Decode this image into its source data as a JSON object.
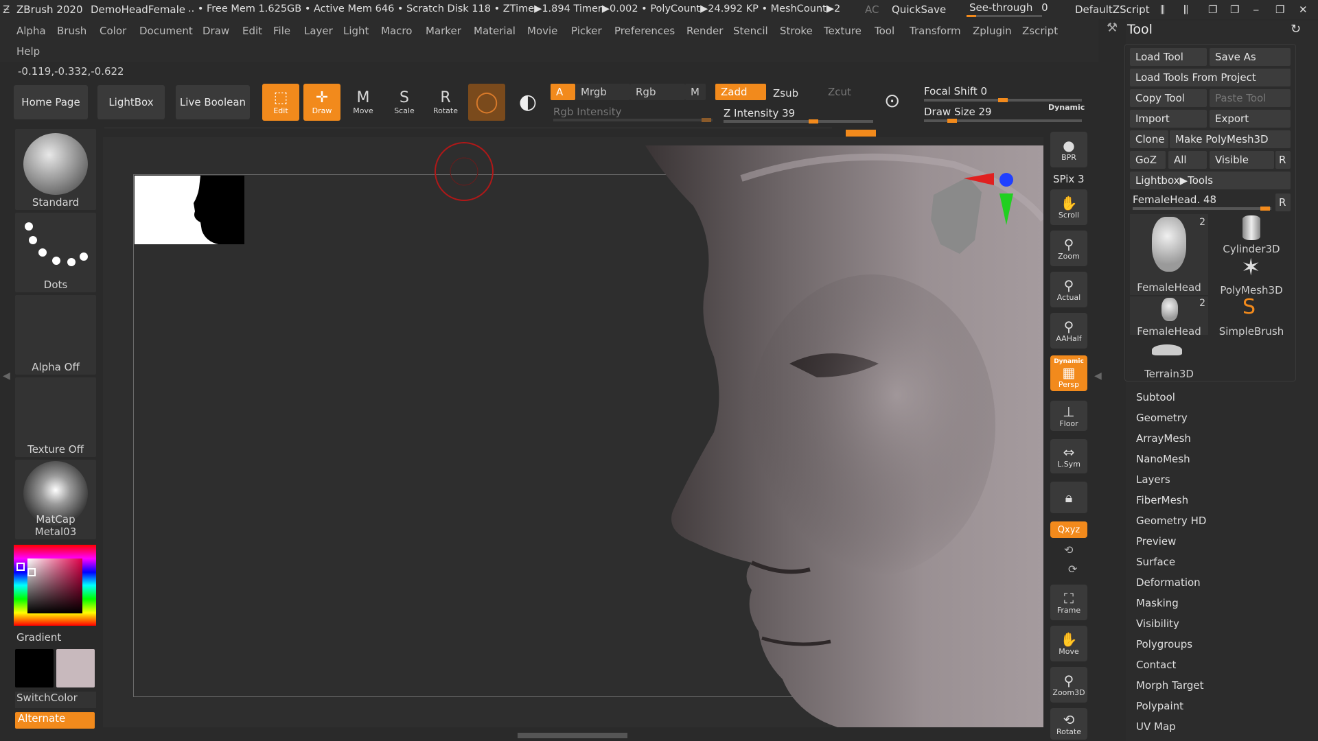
{
  "titlebar": {
    "app": "ZBrush 2020",
    "document": "DemoHeadFemale",
    "stats": ".. • Free Mem 1.625GB • Active Mem 646 • Scratch Disk 118 • ZTime▶1.894 Timer▶0.002 • PolyCount▶24.992 KP • MeshCount▶2",
    "ac": "AC",
    "quicksave": "QuickSave",
    "see_through": "See-through",
    "see_through_value": "0",
    "script": "DefaultZScript"
  },
  "menus": [
    "Alpha",
    "Brush",
    "Color",
    "Document",
    "Draw",
    "Edit",
    "File",
    "Layer",
    "Light",
    "Macro",
    "Marker",
    "Material",
    "Movie",
    "Picker",
    "Preferences",
    "Render",
    "Stencil",
    "Stroke",
    "Texture",
    "Tool",
    "Transform",
    "Zplugin",
    "Zscript"
  ],
  "menu_help": "Help",
  "coords": "-0.119,-0.332,-0.622",
  "top_buttons": {
    "home": "Home Page",
    "lightbox": "LightBox",
    "live_boolean": "Live Boolean"
  },
  "tool_icons": [
    {
      "label": "Edit",
      "icon": "edit-icon",
      "active": true
    },
    {
      "label": "Draw",
      "icon": "draw-icon",
      "active": true
    },
    {
      "label": "Move",
      "icon": "move-icon",
      "active": false
    },
    {
      "label": "Scale",
      "icon": "scale-icon",
      "active": false
    },
    {
      "label": "Rotate",
      "icon": "rotate-icon",
      "active": false
    }
  ],
  "color_controls": {
    "a": "A",
    "mrgb": "Mrgb",
    "rgb": "Rgb",
    "m": "M",
    "zadd": "Zadd",
    "zsub": "Zsub",
    "zcut": "Zcut",
    "rgb_intensity": "Rgb Intensity",
    "z_intensity": "Z Intensity 39"
  },
  "brush_controls": {
    "focal_shift": "Focal Shift 0",
    "draw_size": "Draw Size 29",
    "dynamic": "Dynamic"
  },
  "left_panel": {
    "brush": "Standard",
    "stroke": "Dots",
    "alpha": "Alpha Off",
    "texture": "Texture Off",
    "material": "MatCap Metal03",
    "gradient": "Gradient",
    "switch_color": "SwitchColor",
    "alternate": "Alternate"
  },
  "right_strip": {
    "bpr": "BPR",
    "spix": "SPix 3",
    "buttons": [
      "Scroll",
      "Zoom",
      "Actual",
      "AAHalf"
    ],
    "persp_top": "Dynamic",
    "persp": "Persp",
    "floor": "Floor",
    "lsym": "L.Sym",
    "xyz": "Qxyz",
    "bottom": [
      "Frame",
      "Move",
      "Zoom3D",
      "Rotate"
    ]
  },
  "tool_panel": {
    "title": "Tool",
    "load_tool": "Load Tool",
    "save_as": "Save As",
    "load_from_project": "Load Tools From Project",
    "copy_tool": "Copy Tool",
    "paste_tool": "Paste Tool",
    "import": "Import",
    "export": "Export",
    "clone": "Clone",
    "make_polymesh": "Make PolyMesh3D",
    "goz": "GoZ",
    "all": "All",
    "visible": "Visible",
    "r": "R",
    "lightbox_tools": "Lightbox▶Tools",
    "current_tool": "FemaleHead. 48",
    "thumbs": [
      {
        "label": "FemaleHead",
        "count": "2"
      },
      {
        "label": "Cylinder3D",
        "count": ""
      },
      {
        "label": "PolyMesh3D",
        "count": ""
      },
      {
        "label": "FemaleHead",
        "count": "2"
      },
      {
        "label": "SimpleBrush",
        "count": ""
      },
      {
        "label": "Terrain3D",
        "count": ""
      }
    ],
    "subpalettes": [
      "Subtool",
      "Geometry",
      "ArrayMesh",
      "NanoMesh",
      "Layers",
      "FiberMesh",
      "Geometry HD",
      "Preview",
      "Surface",
      "Deformation",
      "Masking",
      "Visibility",
      "Polygroups",
      "Contact",
      "Morph Target",
      "Polypaint",
      "UV Map"
    ]
  },
  "colors": {
    "accent": "#f28a1c",
    "bg": "#2a2a2a",
    "panel": "#2c2c2c",
    "main_color": "#000000",
    "secondary_color": "#c8b9bd"
  }
}
